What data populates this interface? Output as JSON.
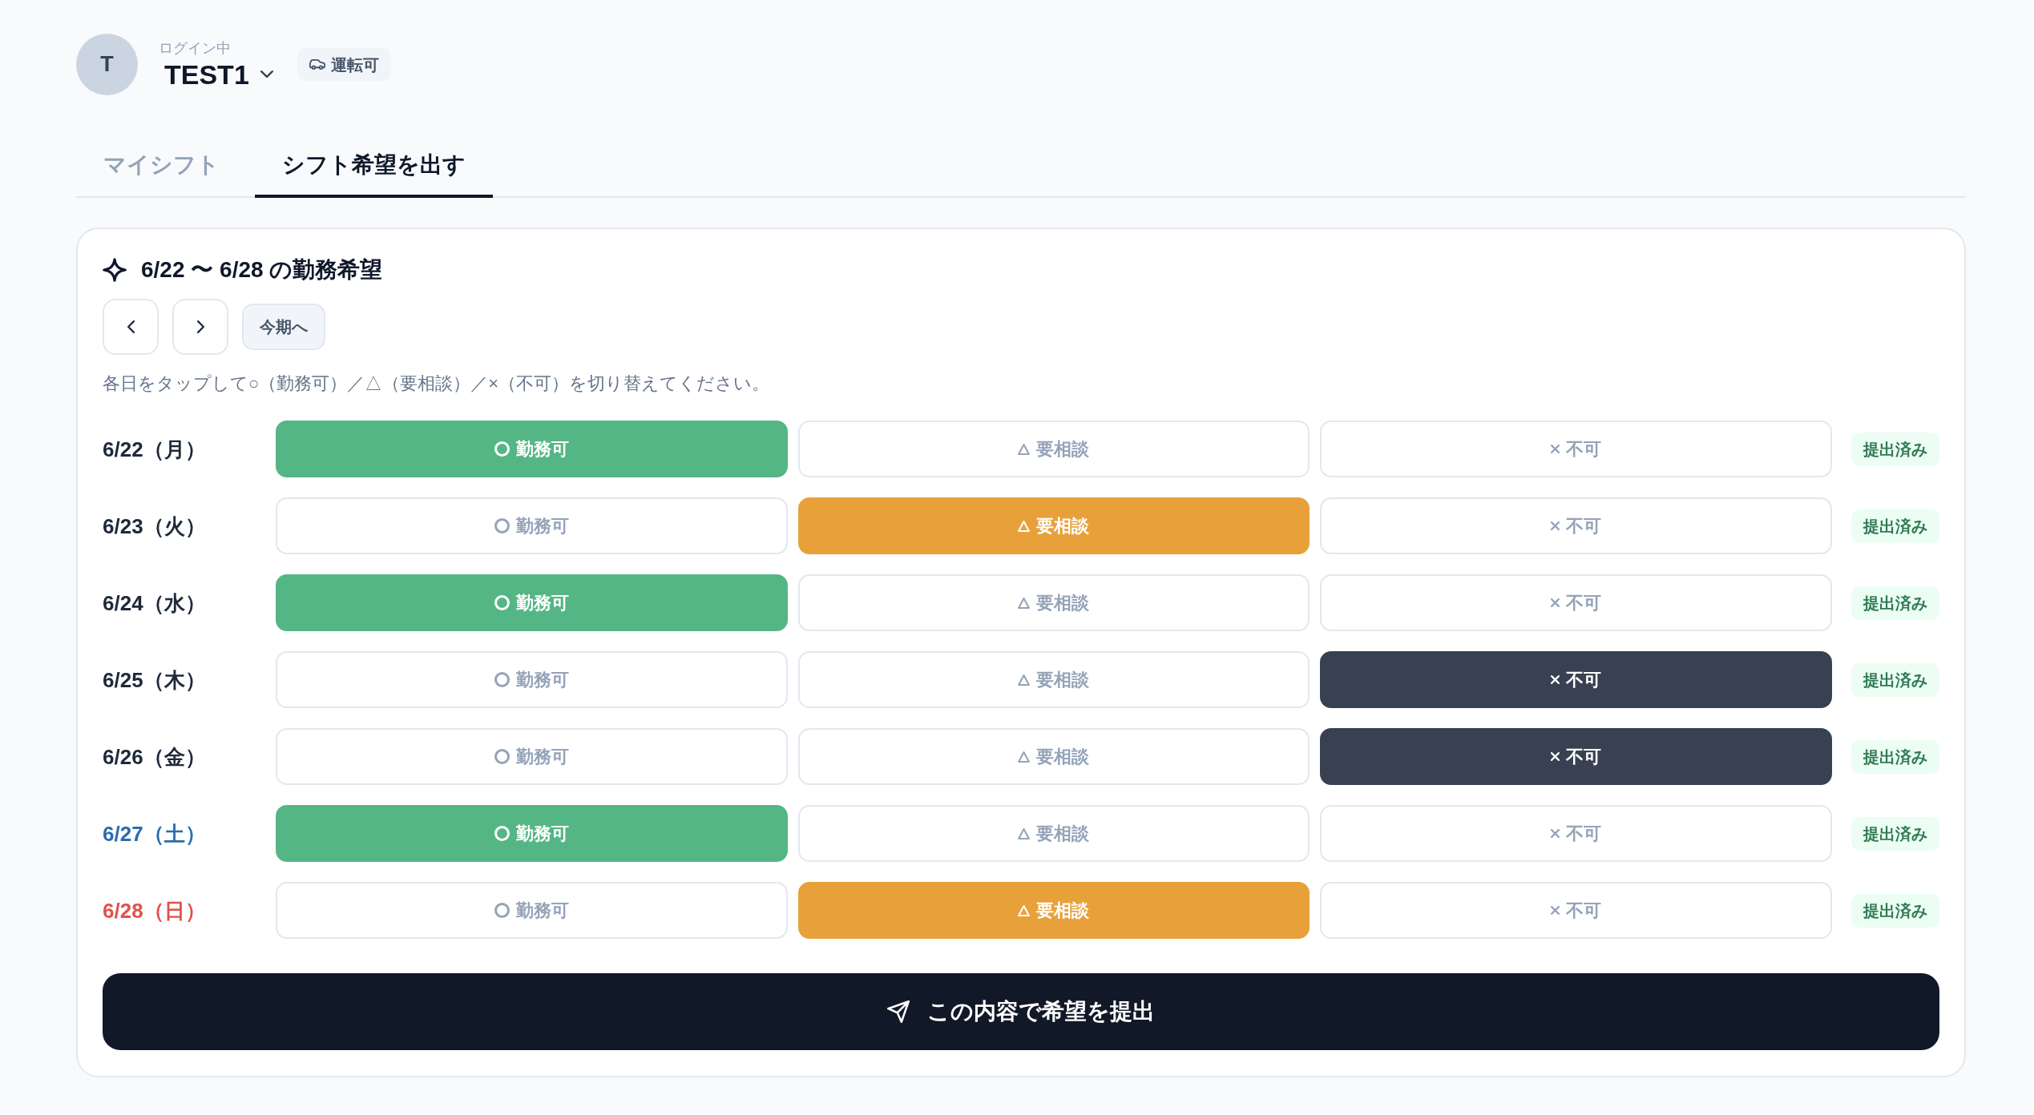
{
  "user": {
    "avatar_initial": "T",
    "login_label": "ログイン中",
    "name": "TEST1",
    "license_tag": "運転可"
  },
  "tabs": [
    {
      "label": "マイシフト",
      "selected": false
    },
    {
      "label": "シフト希望を出す",
      "selected": true
    }
  ],
  "request_panel": {
    "title": "6/22 〜 6/28 の勤務希望",
    "current_period_button": "今期へ",
    "instructions": "各日をタップして○（勤務可）／△（要相談）／×（不可）を切り替えてください。",
    "days": [
      {
        "date": "6/22（月）",
        "color": "#1e293b",
        "status": "提出済み",
        "options": [
          {
            "kind": "available",
            "label": "勤務可",
            "selected": true
          },
          {
            "kind": "consult",
            "label": "要相談",
            "selected": false
          },
          {
            "kind": "unavailable",
            "label": "不可",
            "selected": false
          }
        ]
      },
      {
        "date": "6/23（火）",
        "color": "#1e293b",
        "status": "提出済み",
        "options": [
          {
            "kind": "available",
            "label": "勤務可",
            "selected": false
          },
          {
            "kind": "consult",
            "label": "要相談",
            "selected": true
          },
          {
            "kind": "unavailable",
            "label": "不可",
            "selected": false
          }
        ]
      },
      {
        "date": "6/24（水）",
        "color": "#1e293b",
        "status": "提出済み",
        "options": [
          {
            "kind": "available",
            "label": "勤務可",
            "selected": true
          },
          {
            "kind": "consult",
            "label": "要相談",
            "selected": false
          },
          {
            "kind": "unavailable",
            "label": "不可",
            "selected": false
          }
        ]
      },
      {
        "date": "6/25（木）",
        "color": "#1e293b",
        "status": "提出済み",
        "options": [
          {
            "kind": "available",
            "label": "勤務可",
            "selected": false
          },
          {
            "kind": "consult",
            "label": "要相談",
            "selected": false
          },
          {
            "kind": "unavailable",
            "label": "不可",
            "selected": true
          }
        ]
      },
      {
        "date": "6/26（金）",
        "color": "#1e293b",
        "status": "提出済み",
        "options": [
          {
            "kind": "available",
            "label": "勤務可",
            "selected": false
          },
          {
            "kind": "consult",
            "label": "要相談",
            "selected": false
          },
          {
            "kind": "unavailable",
            "label": "不可",
            "selected": true
          }
        ]
      },
      {
        "date": "6/27（土）",
        "color": "#2b6cb0",
        "status": "提出済み",
        "options": [
          {
            "kind": "available",
            "label": "勤務可",
            "selected": true
          },
          {
            "kind": "consult",
            "label": "要相談",
            "selected": false
          },
          {
            "kind": "unavailable",
            "label": "不可",
            "selected": false
          }
        ]
      },
      {
        "date": "6/28（日）",
        "color": "#e0524a",
        "status": "提出済み",
        "options": [
          {
            "kind": "available",
            "label": "勤務可",
            "selected": false
          },
          {
            "kind": "consult",
            "label": "要相談",
            "selected": true
          },
          {
            "kind": "unavailable",
            "label": "不可",
            "selected": false
          }
        ]
      }
    ],
    "submit_button": "この内容で希望を提出"
  }
}
